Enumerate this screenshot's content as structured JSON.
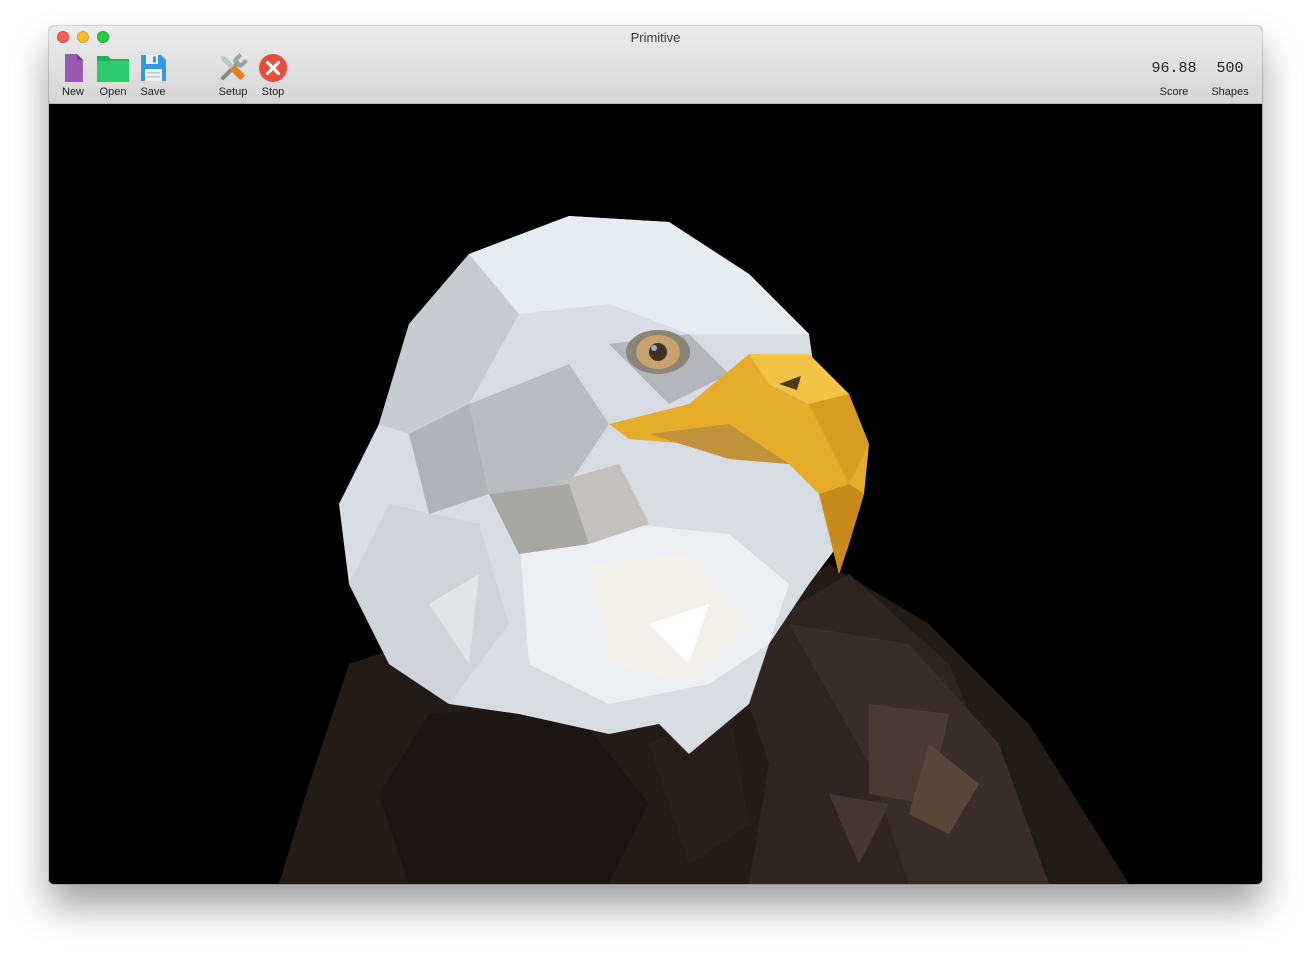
{
  "window": {
    "title": "Primitive"
  },
  "toolbar": {
    "new_label": "New",
    "open_label": "Open",
    "save_label": "Save",
    "setup_label": "Setup",
    "stop_label": "Stop"
  },
  "stats": {
    "score_value": "96.88",
    "score_label": "Score",
    "shapes_value": "500",
    "shapes_label": "Shapes"
  },
  "icons": {
    "new": "document-icon",
    "open": "folder-icon",
    "save": "floppy-disk-icon",
    "setup": "tools-icon",
    "stop": "stop-icon"
  },
  "colors": {
    "new_icon": "#9b59b6",
    "open_icon": "#2ecc71",
    "save_icon": "#3498db",
    "stop_icon": "#e74c3c",
    "canvas_background": "#000000",
    "beak": "#e6ad2b",
    "head_feathers": "#dfe6ee",
    "body_feathers": "#2e221d"
  }
}
